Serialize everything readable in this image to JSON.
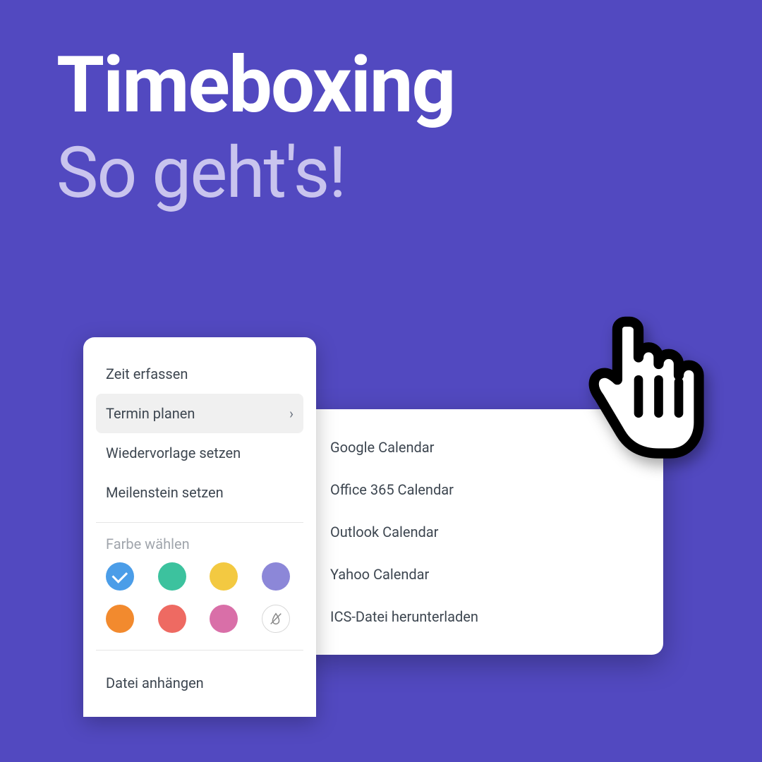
{
  "title": {
    "line1": "Timeboxing",
    "line2": "So geht's!"
  },
  "menu": {
    "items": [
      {
        "label": "Zeit erfassen",
        "has_submenu": false,
        "selected": false
      },
      {
        "label": "Termin planen",
        "has_submenu": true,
        "selected": true
      },
      {
        "label": "Wiedervorlage setzen",
        "has_submenu": false,
        "selected": false
      },
      {
        "label": "Meilenstein setzen",
        "has_submenu": false,
        "selected": false
      }
    ],
    "color_section_label": "Farbe wählen",
    "colors": [
      {
        "hex": "#4b9de8",
        "checked": true
      },
      {
        "hex": "#3cc29e",
        "checked": false
      },
      {
        "hex": "#f3c941",
        "checked": false
      },
      {
        "hex": "#8c87d8",
        "checked": false
      },
      {
        "hex": "#f28a2e",
        "checked": false
      },
      {
        "hex": "#ee6a62",
        "checked": false
      },
      {
        "hex": "#d96fa8",
        "checked": false
      },
      {
        "hex": "none",
        "checked": false
      }
    ],
    "attach_label": "Datei anhängen"
  },
  "submenu": {
    "items": [
      "Google Calendar",
      "Office 365 Calendar",
      "Outlook Calendar",
      "Yahoo Calendar",
      "ICS-Datei herunterladen"
    ]
  }
}
